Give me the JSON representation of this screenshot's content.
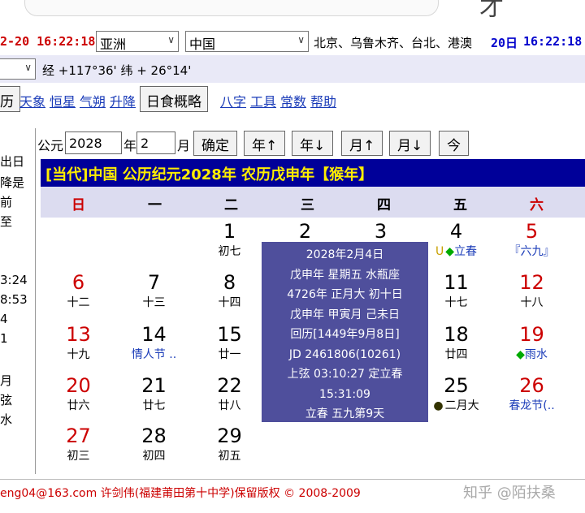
{
  "header": {
    "time_left": "2-20 16:22:18",
    "region": "亚洲",
    "country": "中国",
    "cities": "北京、乌鲁木齐、台北、港澳",
    "time_right_date": "20日",
    "time_right_clock": "16:22:18",
    "top_glyph": "才"
  },
  "coords": {
    "partial_select": "",
    "text": "经 +117°36' 纬 + 26°14'"
  },
  "menu": {
    "buttons": [
      "历",
      "日食概略"
    ],
    "links": [
      "天象",
      "恒星",
      "气朔",
      "升降",
      "八字",
      "工具",
      "常数",
      "帮助"
    ]
  },
  "left_fragments": [
    "出日",
    "降是",
    "前",
    "至",
    "3:24",
    "8:53",
    "4",
    "1",
    "月",
    "弦",
    "水"
  ],
  "controls": {
    "label_gongyuan": "公元",
    "year": "2028",
    "label_year": "年",
    "month": "2",
    "label_month": "月",
    "confirm": "确定",
    "year_up": "年↑",
    "year_down": "年↓",
    "month_up": "月↑",
    "month_down": "月↓",
    "today": "今"
  },
  "calendar_title": "[当代]中国 公历纪元2028年 农历戊申年【猴年】",
  "weekdays": [
    "日",
    "一",
    "二",
    "三",
    "四",
    "五",
    "六"
  ],
  "days": [
    {
      "num": "1",
      "sub": "初七",
      "col": 2,
      "row": 0
    },
    {
      "num": "2",
      "sub": "",
      "col": 3,
      "row": 0
    },
    {
      "num": "3",
      "sub": "",
      "col": 4,
      "row": 0
    },
    {
      "num": "4",
      "sub": "◆立春",
      "prefix": "U",
      "col": 5,
      "row": 0,
      "sub_color": "blue"
    },
    {
      "num": "5",
      "sub": "『六九』",
      "col": 6,
      "row": 0,
      "red": true,
      "sub_color": "blue"
    },
    {
      "num": "6",
      "sub": "十二",
      "col": 0,
      "row": 1,
      "red": true
    },
    {
      "num": "7",
      "sub": "十三",
      "col": 1,
      "row": 1
    },
    {
      "num": "8",
      "sub": "十四",
      "col": 2,
      "row": 1
    },
    {
      "num": "11",
      "sub": "十七",
      "col": 5,
      "row": 1
    },
    {
      "num": "12",
      "sub": "十八",
      "col": 6,
      "row": 1,
      "red": true
    },
    {
      "num": "13",
      "sub": "十九",
      "col": 0,
      "row": 2,
      "red": true
    },
    {
      "num": "14",
      "sub": "情人节 ..",
      "col": 1,
      "row": 2,
      "sub_color": "blue"
    },
    {
      "num": "15",
      "sub": "廿一",
      "col": 2,
      "row": 2
    },
    {
      "num": "18",
      "sub": "廿四",
      "col": 5,
      "row": 2
    },
    {
      "num": "19",
      "sub": "◆雨水",
      "col": 6,
      "row": 2,
      "red": true,
      "sub_color": "blue"
    },
    {
      "num": "20",
      "sub": "廿六",
      "col": 0,
      "row": 3,
      "red": true
    },
    {
      "num": "21",
      "sub": "廿七",
      "col": 1,
      "row": 3
    },
    {
      "num": "22",
      "sub": "廿八",
      "col": 2,
      "row": 3
    },
    {
      "num": "25",
      "sub": "二月大",
      "prefix": "●",
      "col": 5,
      "row": 3
    },
    {
      "num": "26",
      "sub": "春龙节(..",
      "col": 6,
      "row": 3,
      "red": true,
      "sub_color": "blue"
    },
    {
      "num": "27",
      "sub": "初三",
      "col": 0,
      "row": 4,
      "red": true
    },
    {
      "num": "28",
      "sub": "初四",
      "col": 1,
      "row": 4
    },
    {
      "num": "29",
      "sub": "初五",
      "col": 2,
      "row": 4
    }
  ],
  "popup": [
    "2028年2月4日",
    "戊申年 星期五 水瓶座",
    "4726年 正月大 初十日",
    "戊申年 甲寅月 己未日",
    "回历[1449年9月8日]",
    "JD 2461806(10261)",
    "上弦 03:10:27 定立春",
    "15:31:09",
    "立春 五九第9天"
  ],
  "footer": {
    "copyright": "eng04@163.com 许剑伟(福建莆田第十中学)保留版权 © 2008-2009",
    "watermark": "知乎 @陌扶桑"
  },
  "colors": {
    "title_bg": "#000099",
    "title_fg": "#ffee00",
    "popup_bg": "#4f4f9c",
    "weekday_bg": "#dcdcf0",
    "holiday_red": "#cc0000",
    "link_blue": "#1a3bb8",
    "coord_bar": "#e9e9f7"
  }
}
